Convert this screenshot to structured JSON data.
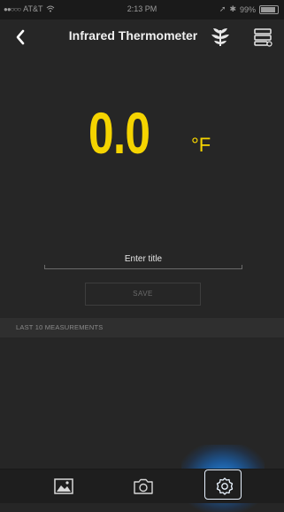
{
  "status_bar": {
    "carrier": "AT&T",
    "time": "2:13 PM",
    "battery": "99%"
  },
  "navbar": {
    "title": "Infrared Thermometer",
    "icons": [
      "back-icon",
      "plant-icon",
      "server-icon"
    ]
  },
  "reading": {
    "value": "0.0",
    "unit": "°F"
  },
  "form": {
    "title_placeholder": "Enter title",
    "save_label": "SAVE"
  },
  "measurements": {
    "header": "LAST 10 MEASUREMENTS",
    "items": []
  },
  "tabbar": {
    "tabs": [
      "gallery-icon",
      "camera-icon",
      "settings-icon"
    ],
    "active": "settings-icon"
  },
  "colors": {
    "background": "#262626",
    "reading": "#f5d400",
    "active_tab_glow": "#288ce6"
  }
}
